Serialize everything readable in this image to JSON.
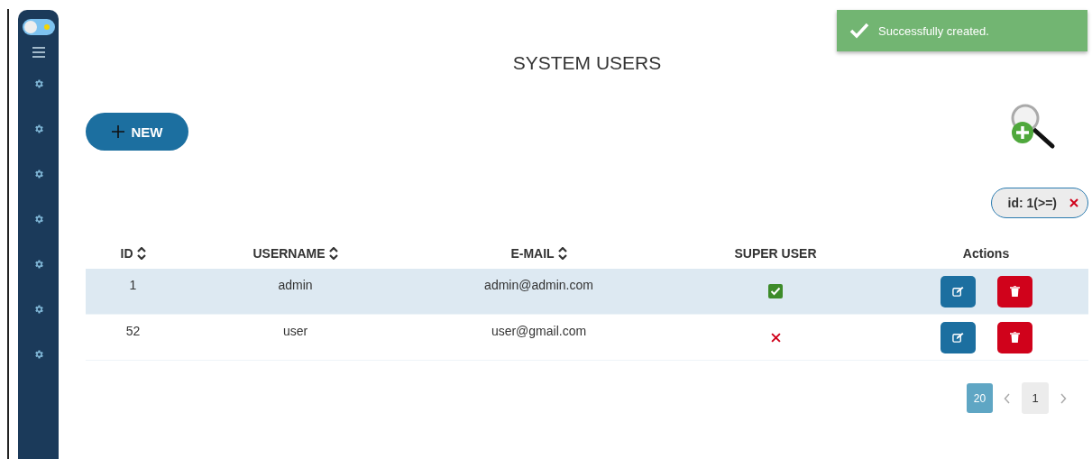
{
  "sidebar": {
    "theme_toggle": {
      "on": false
    },
    "items": [
      {
        "kind": "gear"
      },
      {
        "kind": "gear"
      },
      {
        "kind": "gear"
      },
      {
        "kind": "gear"
      },
      {
        "kind": "gear"
      },
      {
        "kind": "gear"
      },
      {
        "kind": "gear"
      }
    ]
  },
  "toast": {
    "message": "Successfully created."
  },
  "title": "SYSTEM USERS",
  "new_button": {
    "label": "NEW"
  },
  "filters": [
    {
      "label": "id: 1(>=)"
    }
  ],
  "table": {
    "columns": [
      {
        "label": "ID",
        "sortable": true
      },
      {
        "label": "USERNAME",
        "sortable": true
      },
      {
        "label": "E-MAIL",
        "sortable": true
      },
      {
        "label": "SUPER USER",
        "sortable": false
      },
      {
        "label": "Actions",
        "sortable": false
      }
    ],
    "rows": [
      {
        "id": "1",
        "username": "admin",
        "email": "admin@admin.com",
        "super_user": true,
        "selected": true
      },
      {
        "id": "52",
        "username": "user",
        "email": "user@gmail.com",
        "super_user": false,
        "selected": false
      }
    ]
  },
  "pagination": {
    "page_size": "20",
    "pages": [
      {
        "label": "1",
        "selected": true
      }
    ]
  }
}
